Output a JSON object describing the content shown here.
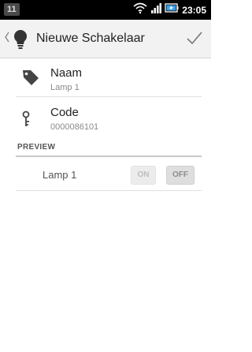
{
  "statusbar": {
    "notification_count": "11",
    "time": "23:05",
    "icons": [
      "wifi-icon",
      "signal-icon",
      "battery-charging-icon"
    ]
  },
  "actionbar": {
    "title": "Nieuwe Schakelaar",
    "icons": [
      "up-caret-icon",
      "bulb-app-icon",
      "checkmark-icon"
    ]
  },
  "fields": {
    "name": {
      "label": "Naam",
      "value": "Lamp 1",
      "icon": "tag-icon"
    },
    "code": {
      "label": "Code",
      "value": "0000086101",
      "icon": "key-icon"
    }
  },
  "preview": {
    "header": "PREVIEW",
    "item_label": "Lamp 1",
    "on_label": "ON",
    "off_label": "OFF"
  },
  "colors": {
    "statusbar": "#000000",
    "actionbar": "#f2f2f2",
    "background": "#ffffff"
  }
}
